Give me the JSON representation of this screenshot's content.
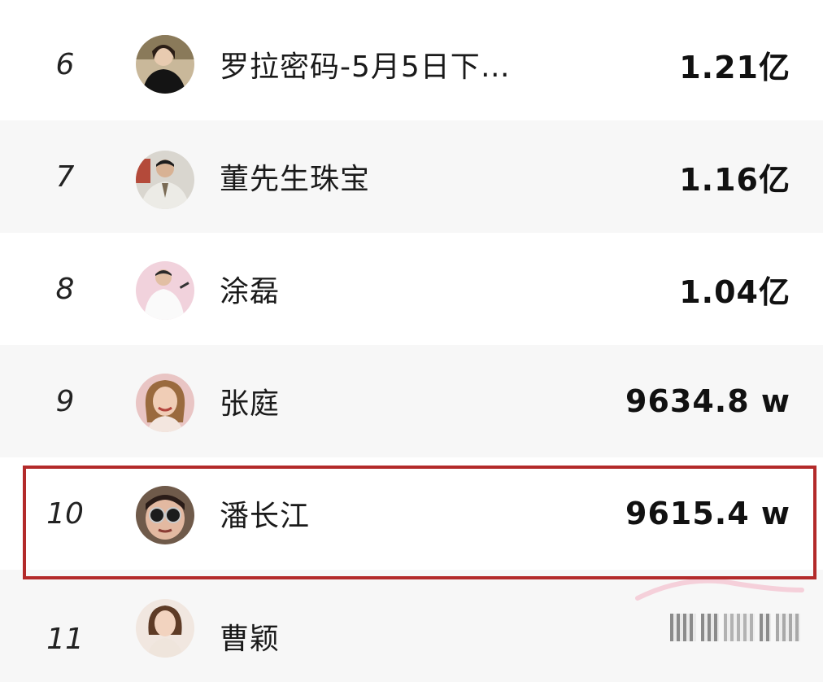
{
  "rows": [
    {
      "rank": "6",
      "name": "罗拉密码-5月5日下…",
      "value": "1.21亿",
      "avatar": "female-avatar-dark"
    },
    {
      "rank": "7",
      "name": "董先生珠宝",
      "value": "1.16亿",
      "avatar": "male-avatar-suit"
    },
    {
      "rank": "8",
      "name": "涂磊",
      "value": "1.04亿",
      "avatar": "male-avatar-pink"
    },
    {
      "rank": "9",
      "name": "张庭",
      "value": "9634.8 w",
      "avatar": "female-avatar-smile"
    },
    {
      "rank": "10",
      "name": "潘长江",
      "value": "9615.4 w",
      "avatar": "male-avatar-sunglasses",
      "highlighted": true
    },
    {
      "rank": "11",
      "name": "曹颖",
      "value": "",
      "avatar": "female-avatar-light"
    }
  ],
  "colors": {
    "highlight_border": "#b32a2a",
    "row_shade": "#f7f7f7",
    "text": "#1a1a1a"
  }
}
